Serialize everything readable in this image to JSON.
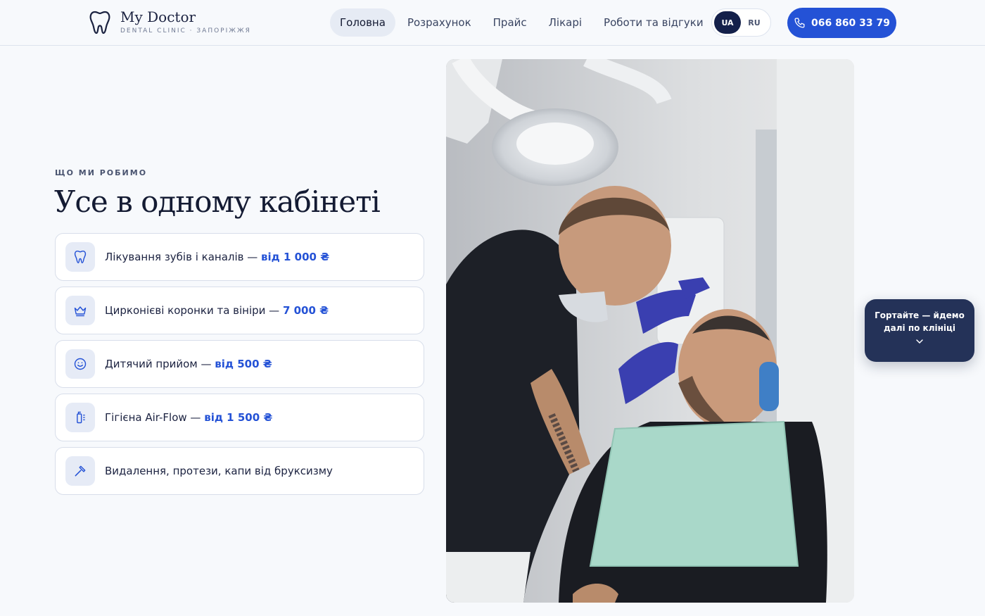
{
  "progress": 0.853,
  "brand": {
    "name": "My Doctor",
    "subtitle": "DENTAL CLINIC · ЗАПОРІЖЖЯ",
    "icon": "tooth-icon"
  },
  "nav": {
    "items": [
      {
        "label": "Головна",
        "active": true
      },
      {
        "label": "Розрахунок",
        "active": false
      },
      {
        "label": "Прайс",
        "active": false
      },
      {
        "label": "Лікарі",
        "active": false
      },
      {
        "label": "Роботи та відгуки",
        "active": false
      }
    ]
  },
  "lang": {
    "options": [
      "UA",
      "RU"
    ],
    "active": "UA"
  },
  "phone": {
    "label": "066 860 33 79",
    "icon": "phone-icon"
  },
  "section": {
    "eyebrow": "ЩО МИ РОБИМО",
    "title": "Усе в одному кабінеті"
  },
  "services": [
    {
      "text": "Лікування зубів і каналів — ",
      "price": "від 1 000 ₴",
      "icon": "tooth-icon"
    },
    {
      "text": "Цирконієві коронки та вініри — ",
      "price": "7 000 ₴",
      "icon": "crown-icon"
    },
    {
      "text": "Дитячий прийом — ",
      "price": "від 500 ₴",
      "icon": "smile-icon"
    },
    {
      "text": "Гігієна Air-Flow — ",
      "price": "від 1 500 ₴",
      "icon": "airflow-icon"
    },
    {
      "text": "Видалення, протези, капи від бруксизму",
      "price": "",
      "icon": "tool-icon"
    }
  ],
  "scroll_hint": {
    "line1": "Гортайте — йдемо",
    "line2": "далі по клініці",
    "icon": "chevron-down-icon"
  },
  "colors": {
    "accent": "#2452d6",
    "dark": "#141b33",
    "hint_bg": "#243258"
  }
}
